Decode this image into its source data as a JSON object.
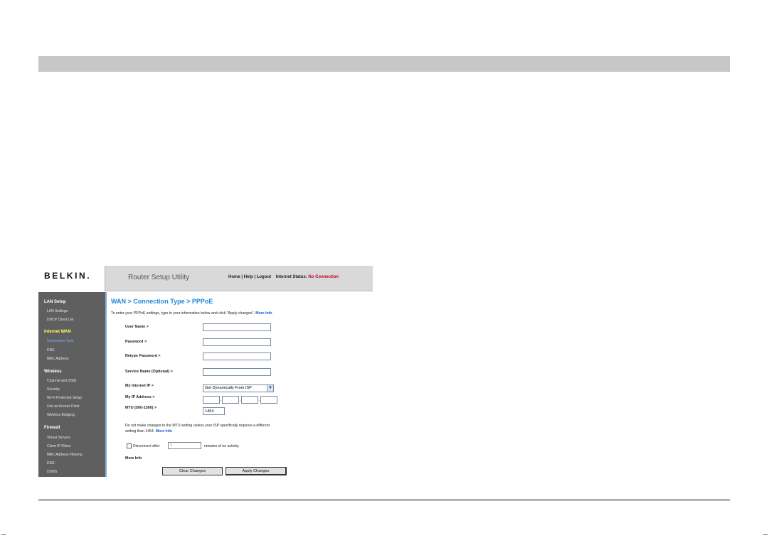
{
  "header": {
    "logo": "BELKIN.",
    "app_title": "Router Setup Utility",
    "links": {
      "home": "Home",
      "help": "Help",
      "logout": "Logout"
    },
    "status_label": "Internet Status:",
    "status_value": "No Connection"
  },
  "sidebar": {
    "sections": [
      {
        "title": "LAN Setup",
        "items": [
          "LAN Settings",
          "DHCP Client List"
        ]
      },
      {
        "title": "Internet WAN",
        "items": [
          "Connection Type",
          "DNS",
          "MAC Address"
        ]
      },
      {
        "title": "Wireless",
        "items": [
          "Channel and SSID",
          "Security",
          "Wi-Fi Protected Setup",
          "Use as Access Point",
          "Wireless Bridging"
        ]
      },
      {
        "title": "Firewall",
        "items": [
          "Virtual Servers",
          "Client IP Filters",
          "MAC Address Filtering",
          "DMZ",
          "DDNS"
        ]
      }
    ],
    "active_section": "Internet WAN",
    "active_item": "Connection Type"
  },
  "main": {
    "heading": "WAN > Connection Type > PPPoE",
    "intro": "To enter your PPPoE settings, type in your information below and click \"Apply changes\".",
    "more_info": "More Info",
    "fields": {
      "user_name": "User Name >",
      "password": "Password >",
      "retype_password": "Retype Password >",
      "service_name": "Service Name (Optional) >",
      "my_internet_ip": "My Internet IP >",
      "my_ip_address": "My IP Address >",
      "mtu": "MTU (500-1500) >"
    },
    "internet_ip_selected": "Get Dynamically From ISP",
    "mtu_value": "1454",
    "mtu_note_line1": "Do not make changes to the MTU setting unless your ISP specifically requires a different",
    "mtu_note_line2": "setting than 1454.",
    "disconnect_label": "Disconnect after",
    "disconnect_minutes": "5",
    "disconnect_suffix": "minutes of no activity.",
    "buttons": {
      "clear": "Clear Changes",
      "apply": "Apply Changes"
    }
  }
}
